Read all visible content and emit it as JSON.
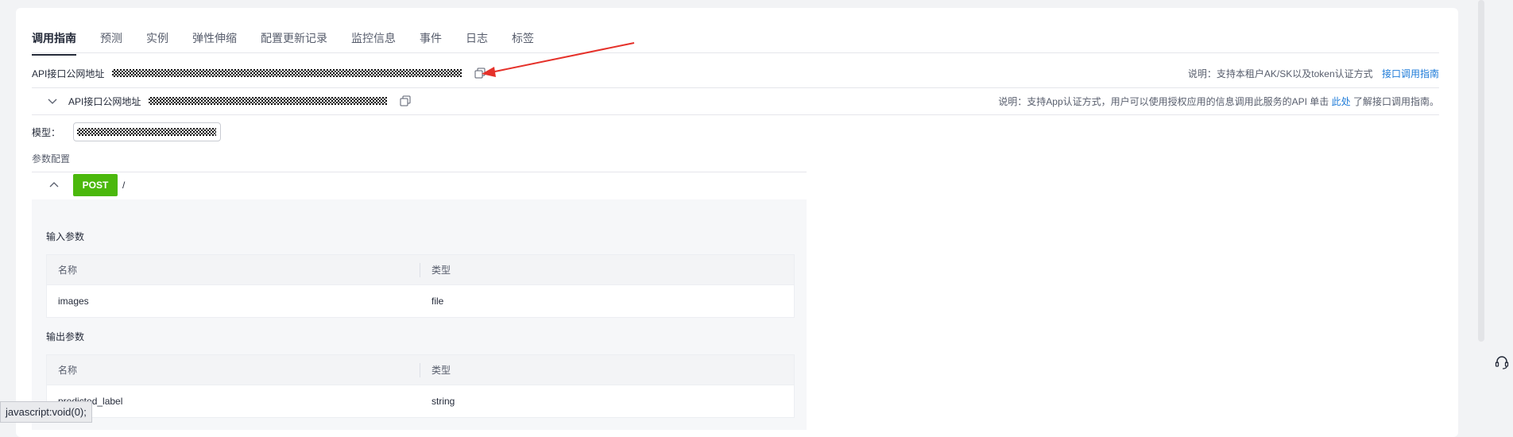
{
  "tabs": [
    "调用指南",
    "预测",
    "实例",
    "弹性伸缩",
    "配置更新记录",
    "监控信息",
    "事件",
    "日志",
    "标签"
  ],
  "api_public": {
    "label": "API接口公网地址",
    "note": "说明：支持本租户AK/SK以及token认证方式",
    "link": "接口调用指南"
  },
  "app_api": {
    "label": "API接口公网地址",
    "note_prefix": "说明：支持App认证方式，用户可以使用授权应用的信息调用此服务的API   单击 ",
    "note_link": "此处",
    "note_suffix": " 了解接口调用指南。"
  },
  "model": {
    "label": "模型："
  },
  "params": {
    "title": "参数配置",
    "method": "POST",
    "path": "/",
    "input": {
      "title": "输入参数",
      "headers": [
        "名称",
        "类型"
      ],
      "rows": [
        [
          "images",
          "file"
        ]
      ]
    },
    "output": {
      "title": "输出参数",
      "headers": [
        "名称",
        "类型"
      ],
      "rows": [
        [
          "predicted_label",
          "string"
        ]
      ]
    }
  },
  "status_bar": "javascript:void(0);",
  "colors": {
    "accent": "#4bb80c",
    "link": "#1e7bd8",
    "arrow": "#e5312a"
  },
  "icons": [
    "copy-icon",
    "chevron-down-icon",
    "chevron-up-icon",
    "headset-icon"
  ]
}
